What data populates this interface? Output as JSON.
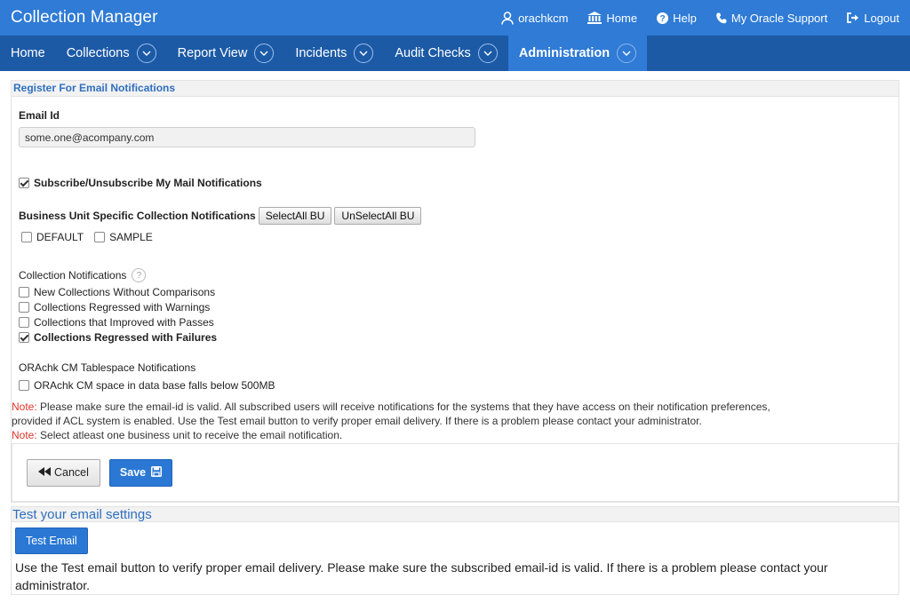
{
  "app": {
    "title": "Collection Manager"
  },
  "toplinks": [
    {
      "label": "orachkcm",
      "icon": "user-icon"
    },
    {
      "label": "Home",
      "icon": "institution-icon"
    },
    {
      "label": "Help",
      "icon": "question-circle-icon"
    },
    {
      "label": "My Oracle Support",
      "icon": "phone-icon"
    },
    {
      "label": "Logout",
      "icon": "sign-out-icon"
    }
  ],
  "nav": [
    {
      "label": "Home",
      "has_dropdown": false,
      "active": false
    },
    {
      "label": "Collections",
      "has_dropdown": true,
      "active": false
    },
    {
      "label": "Report View",
      "has_dropdown": true,
      "active": false
    },
    {
      "label": "Incidents",
      "has_dropdown": true,
      "active": false
    },
    {
      "label": "Audit Checks",
      "has_dropdown": true,
      "active": false
    },
    {
      "label": "Administration",
      "has_dropdown": true,
      "active": true
    }
  ],
  "register": {
    "title": "Register For Email Notifications",
    "email_label": "Email Id",
    "email_value": "some.one@acompany.com",
    "subscribe_label": "Subscribe/Unsubscribe My Mail Notifications",
    "subscribe_checked": true,
    "bu_label": "Business Unit Specific Collection Notifications",
    "select_all_bu": "SelectAll BU",
    "unselect_all_bu": "UnSelectAll BU",
    "bu_options": [
      {
        "label": "DEFAULT",
        "checked": false
      },
      {
        "label": "SAMPLE",
        "checked": false
      }
    ],
    "collection_notif_label": "Collection Notifications",
    "help_glyph": "?",
    "collection_options": [
      {
        "label": "New Collections Without Comparisons",
        "checked": false
      },
      {
        "label": "Collections Regressed with Warnings",
        "checked": false
      },
      {
        "label": "Collections that Improved with Passes",
        "checked": false
      },
      {
        "label": "Collections Regressed with Failures",
        "checked": true
      }
    ],
    "tablespace_label": "ORAchk CM Tablespace Notifications",
    "tablespace_options": [
      {
        "label": "ORAchk CM space in data base falls below 500MB",
        "checked": false
      }
    ],
    "note_label": "Note:",
    "note1_line1": " Please make sure the email-id is valid. All subscribed users will receive notifications for the systems that they have access on their notification preferences,",
    "note1_line2": "provided if ACL system is enabled. Use the Test email button to verify proper email delivery. If there is a problem please contact your administrator.",
    "note2": " Select atleast one business unit to receive the email notification.",
    "cancel_label": "Cancel",
    "save_label": "Save"
  },
  "test": {
    "title": "Test your email settings",
    "button_label": "Test Email",
    "description": "Use the Test email button to verify proper email delivery. Please make sure the subscribed email-id is valid. If there is a problem please contact your administrator."
  },
  "colors": {
    "topbar": "#2f7bd6",
    "navbar": "#1c5aa6",
    "accent": "#2a78d4",
    "note_red": "#e0342b"
  }
}
